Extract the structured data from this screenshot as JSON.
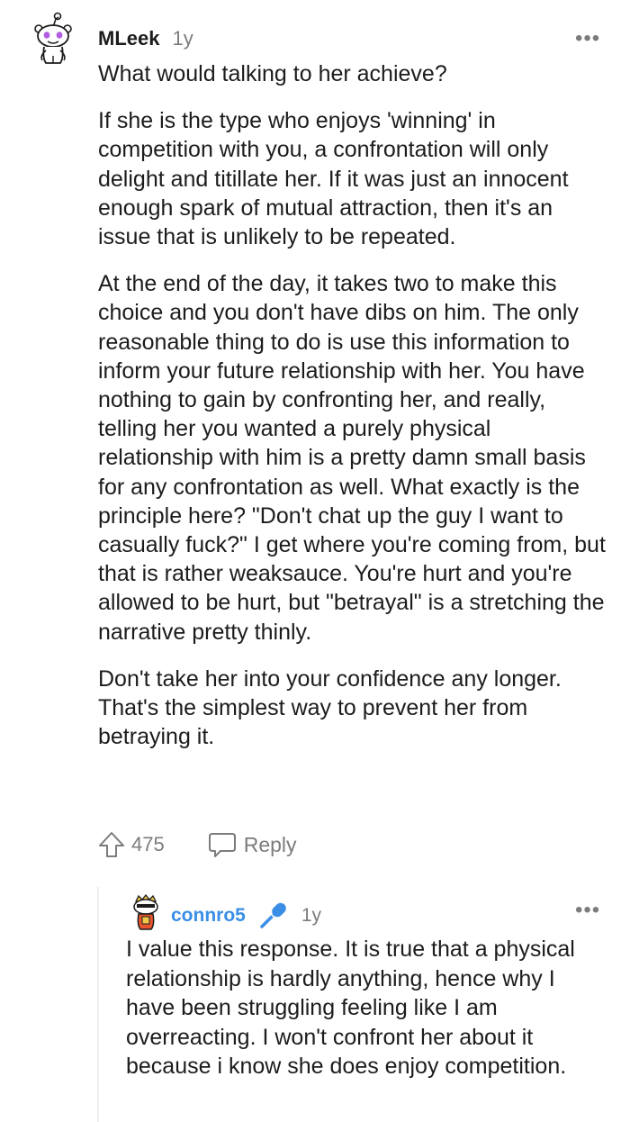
{
  "comment": {
    "username": "MLeek",
    "age": "1y",
    "more_label": "•••",
    "paragraphs": [
      "What would talking to her achieve?",
      "If she is the type who enjoys 'winning' in competition with you, a confrontation will only delight and titillate her. If it was just an innocent enough spark of mutual attraction, then it's an issue that is unlikely to be repeated.",
      "At the end of the day, it takes two to make this choice and you don't have dibs on him. The only reasonable thing to do is use this information to inform your future relationship with her. You have nothing to gain by confronting her, and really, telling her you wanted a purely physical relationship with him is a pretty damn small basis for any confrontation as well. What exactly is the principle here? \"Don't chat up the guy I want to casually fuck?\" I get where you're coming from, but that is rather weaksauce. You're hurt and you're allowed to be hurt, but \"betrayal\" is a stretching the narrative pretty thinly.",
      "Don't take her into your confidence any longer. That's the simplest way to prevent her from betraying it."
    ],
    "votes": "475",
    "reply_label": "Reply"
  },
  "reply": {
    "username": "connro5",
    "age": "1y",
    "more_label": "•••",
    "text": "I value this response. It is true that a physical relationship is hardly anything, hence why I have been struggling feeling like I am overreacting. I won't confront her about it because i know she does enjoy competition."
  },
  "icons": {
    "upvote": "upvote-arrow-icon",
    "reply": "speech-bubble-icon",
    "op_badge": "microphone-icon"
  },
  "colors": {
    "text": "#1c1c1c",
    "meta": "#7c7c7c",
    "op_blue": "#3a8ee6",
    "thread_line": "#edeff1"
  }
}
